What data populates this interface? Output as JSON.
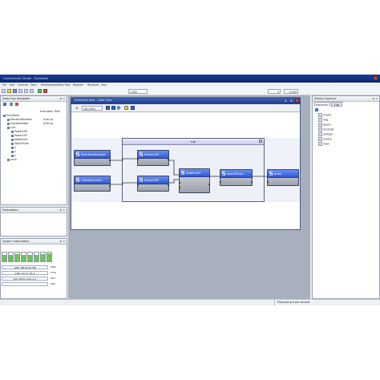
{
  "window": {
    "title": "Connectivity Studio - Euclidiam"
  },
  "menu": [
    "File",
    "Edit",
    "Controls",
    "Tools",
    "Development",
    "Data Flow",
    "Register",
    "Windows",
    "Help"
  ],
  "toolbar": {
    "zoom_value": "1.000",
    "right_value_1": "0",
    "right_value_2": "0.000"
  },
  "data_flow_navigator": {
    "title": "Data Flow Navigator",
    "column_header": "Execution Time",
    "items": [
      {
        "label": "Euclidiam",
        "value": ""
      },
      {
        "label": "RandomNumber",
        "value": "0.00 µs"
      },
      {
        "label": "ConstNumber",
        "value": "0.00 µs"
      },
      {
        "label": "sub",
        "value": ""
      },
      {
        "label": "PowerOfX",
        "value": ""
      },
      {
        "label": "PowerOfY",
        "value": ""
      },
      {
        "label": "addNumX",
        "value": ""
      },
      {
        "label": "SqrtOfSum",
        "value": ""
      },
      {
        "label": "x",
        "value": ""
      },
      {
        "label": "y",
        "value": ""
      },
      {
        "label": "z",
        "value": ""
      },
      {
        "label": "print",
        "value": ""
      }
    ]
  },
  "parameters": {
    "title": "Parameters"
  },
  "system_information": {
    "title": "System Information",
    "cpu_bars": [
      0.75,
      0.7,
      0.8,
      0.7,
      0.75,
      0.7,
      0.8,
      0.95
    ],
    "rows": [
      {
        "value": "1881 MB/2128 MB",
        "label": "Mem"
      },
      {
        "value": "1881 00:17:25.4",
        "label": "Time"
      },
      {
        "value": "CPU Performance 1",
        "label": "Perf"
      },
      {
        "value": "",
        "label": "CPU"
      }
    ]
  },
  "document": {
    "title": "Euclidiam.dfsx - Data Flow",
    "zoom_label": "100.00%",
    "group_label": "sub",
    "nodes": [
      {
        "id": "random",
        "label": "RandomNumber",
        "out": ""
      },
      {
        "id": "const",
        "label": "ConstNumber",
        "out": ""
      },
      {
        "id": "powx",
        "label": "PowerOfX",
        "out": ""
      },
      {
        "id": "powy",
        "label": "PowerOfY",
        "out": ""
      },
      {
        "id": "add",
        "label": "AddNumY",
        "out": ""
      },
      {
        "id": "sqrt",
        "label": "SqrtOfSum",
        "out": ""
      },
      {
        "id": "print",
        "label": "print",
        "out": ""
      }
    ]
  },
  "station_explorer": {
    "title": "Station Explorer",
    "tabs": [
      "Hierarchic",
      "Flat"
    ],
    "items": [
      "charts",
      "img",
      "layers",
      "recorder",
      "sample",
      "source",
      "view"
    ]
  },
  "status": {
    "text": "Processing 0 per second"
  },
  "colors": {
    "title_bar": "#0b2672",
    "node_head": "#2f57d2",
    "panel_border": "#9aa3b3"
  }
}
